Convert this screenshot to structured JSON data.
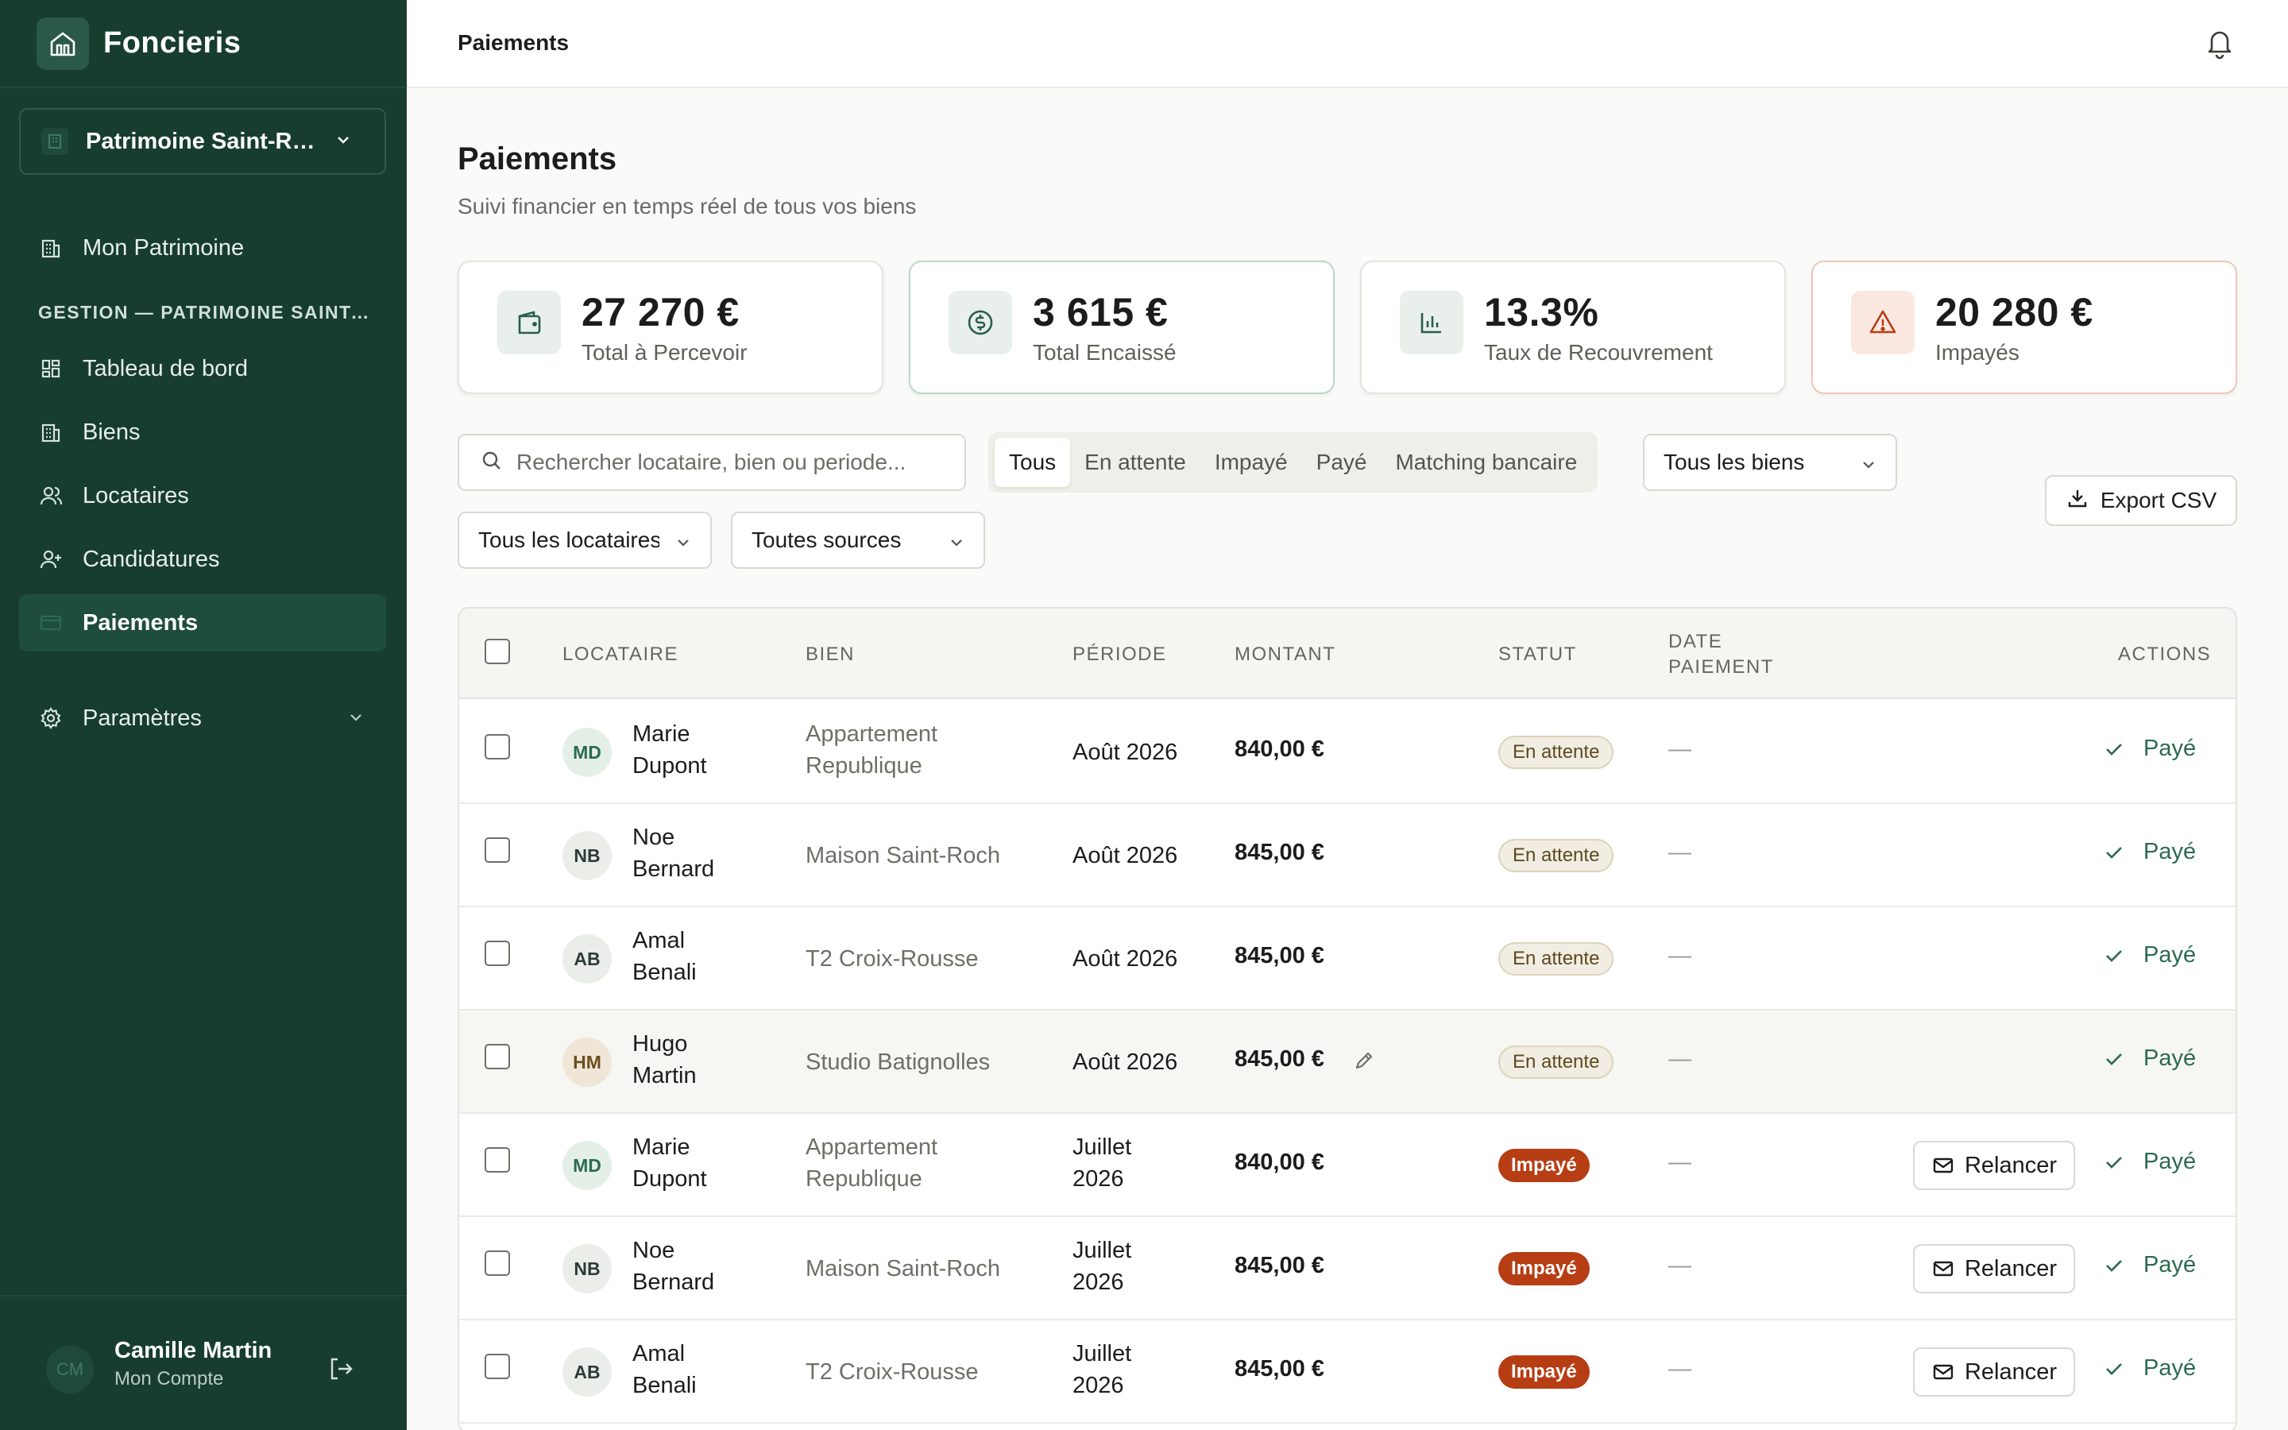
{
  "app": {
    "name": "Foncieris",
    "workspace": "Patrimoine Saint-Roch"
  },
  "sidebar": {
    "top_item": "Mon Patrimoine",
    "section": "GESTION — PATRIMOINE SAINT-ROCH",
    "items": [
      {
        "label": "Tableau de bord",
        "icon": "dashboard-icon"
      },
      {
        "label": "Biens",
        "icon": "building-icon"
      },
      {
        "label": "Locataires",
        "icon": "users-icon"
      },
      {
        "label": "Candidatures",
        "icon": "user-plus-icon"
      },
      {
        "label": "Paiements",
        "icon": "credit-card-icon",
        "active": true
      }
    ],
    "settings": "Paramètres",
    "user": {
      "initials": "CM",
      "name": "Camille Martin",
      "sub": "Mon Compte"
    }
  },
  "topbar": {
    "title": "Paiements"
  },
  "page": {
    "title": "Paiements",
    "subtitle": "Suivi financier en temps réel de tous vos biens"
  },
  "stats": [
    {
      "value": "27 270 €",
      "label": "Total à Percevoir",
      "icon": "wallet-icon"
    },
    {
      "value": "3 615 €",
      "label": "Total Encaissé",
      "icon": "dollar-circle-icon"
    },
    {
      "value": "13.3%",
      "label": "Taux de Recouvrement",
      "icon": "bar-chart-icon"
    },
    {
      "value": "20 280 €",
      "label": "Impayés",
      "icon": "warning-icon"
    }
  ],
  "filters": {
    "search_placeholder": "Rechercher locataire, bien ou periode...",
    "tabs": [
      "Tous",
      "En attente",
      "Impayé",
      "Payé",
      "Matching bancaire"
    ],
    "active_tab": "Tous",
    "biens_select": "Tous les biens",
    "locataires_select": "Tous les locataires",
    "sources_select": "Toutes sources",
    "export_label": "Export CSV"
  },
  "table": {
    "headers": {
      "locataire": "LOCATAIRE",
      "bien": "BIEN",
      "periode": "PÉRIODE",
      "montant": "MONTANT",
      "statut": "STATUT",
      "date_1": "DATE",
      "date_2": "PAIEMENT",
      "actions": "ACTIONS"
    },
    "relancer_label": "Relancer",
    "paye_label": "Payé",
    "rows": [
      {
        "initials": "MD",
        "first": "Marie",
        "last": "Dupont",
        "bien_1": "Appartement",
        "bien_2": "Republique",
        "periode_1": "Août 2026",
        "periode_2": "",
        "montant": "840,00 €",
        "statut": "En attente",
        "date": "—"
      },
      {
        "initials": "NB",
        "first": "Noe",
        "last": "Bernard",
        "bien_1": "Maison Saint-Roch",
        "bien_2": "",
        "periode_1": "Août 2026",
        "periode_2": "",
        "montant": "845,00 €",
        "statut": "En attente",
        "date": "—"
      },
      {
        "initials": "AB",
        "first": "Amal",
        "last": "Benali",
        "bien_1": "T2 Croix-Rousse",
        "bien_2": "",
        "periode_1": "Août 2026",
        "periode_2": "",
        "montant": "845,00 €",
        "statut": "En attente",
        "date": "—"
      },
      {
        "initials": "HM",
        "first": "Hugo",
        "last": "Martin",
        "bien_1": "Studio Batignolles",
        "bien_2": "",
        "periode_1": "Août 2026",
        "periode_2": "",
        "montant": "845,00 €",
        "statut": "En attente",
        "date": "—"
      },
      {
        "initials": "MD",
        "first": "Marie",
        "last": "Dupont",
        "bien_1": "Appartement",
        "bien_2": "Republique",
        "periode_1": "Juillet",
        "periode_2": "2026",
        "montant": "840,00 €",
        "statut": "Impayé",
        "date": "—"
      },
      {
        "initials": "NB",
        "first": "Noe",
        "last": "Bernard",
        "bien_1": "Maison Saint-Roch",
        "bien_2": "",
        "periode_1": "Juillet",
        "periode_2": "2026",
        "montant": "845,00 €",
        "statut": "Impayé",
        "date": "—"
      },
      {
        "initials": "AB",
        "first": "Amal",
        "last": "Benali",
        "bien_1": "T2 Croix-Rousse",
        "bien_2": "",
        "periode_1": "Juillet",
        "periode_2": "2026",
        "montant": "845,00 €",
        "statut": "Impayé",
        "date": "—"
      }
    ]
  },
  "colors": {
    "sidebar": "#173d2f",
    "accent": "#2b6b4f",
    "unpaid": "#b73d14",
    "waiting": "#f1ede2"
  }
}
